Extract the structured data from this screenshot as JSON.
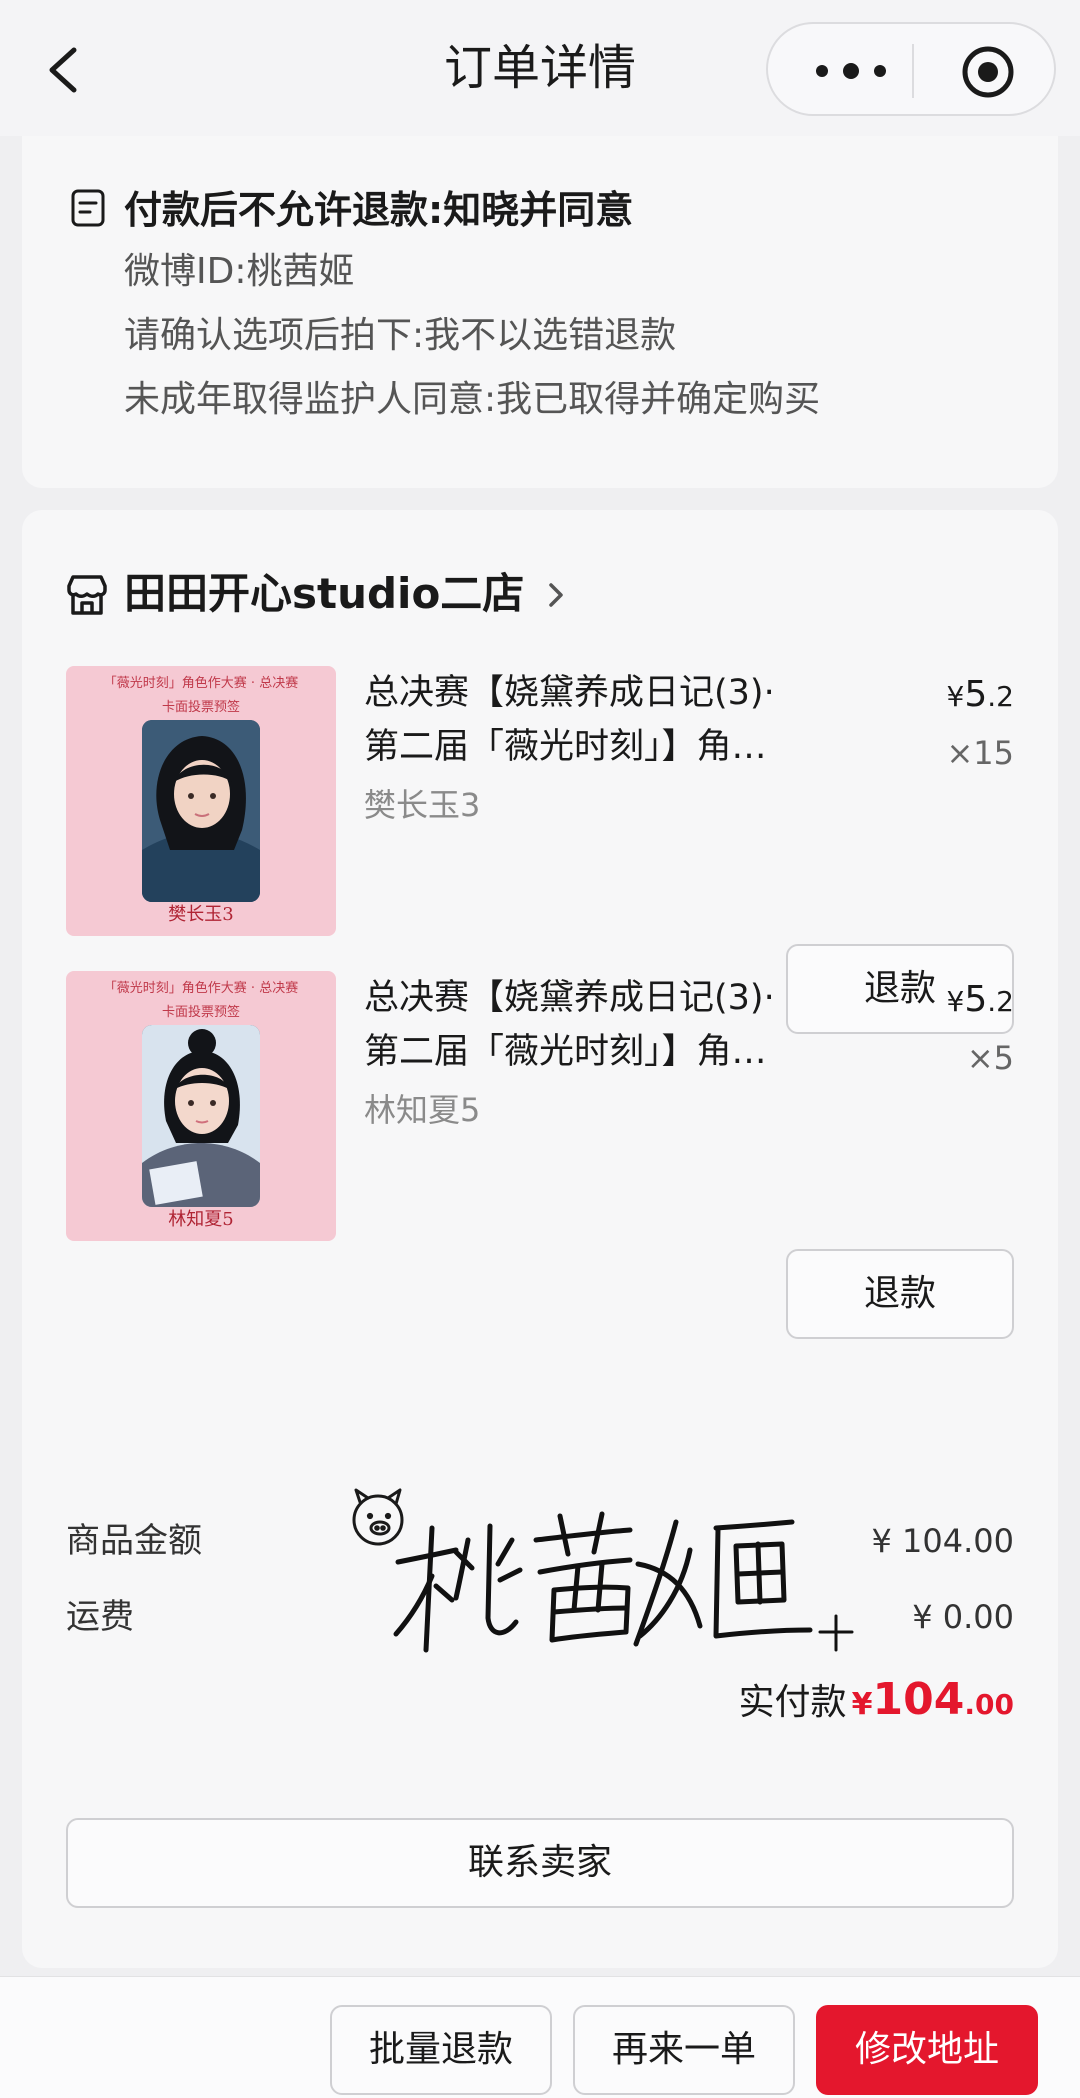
{
  "nav": {
    "title": "订单详情",
    "back_icon": "chevron-left-icon",
    "more_icon": "more-dots-icon",
    "close_icon": "target-circle-icon"
  },
  "remark": {
    "title": "付款后不允许退款:知晓并同意",
    "lines": [
      "微博ID:桃茜姬",
      "请确认选项后拍下:我不以选错退款",
      "未成年取得监护人同意:我已取得并确定购买"
    ]
  },
  "shop": {
    "name": "田田开心studio二店"
  },
  "items": [
    {
      "title_line1": "总决赛【娆黛养成日记(3)·",
      "title_line2": "第二届「薇光时刻」】角…",
      "spec": "樊长玉3",
      "price_currency": "¥",
      "price_int": "5",
      "price_dec": ".2",
      "qty": "×15",
      "refund_label": "退款",
      "thumb_header": "「薇光时刻」角色作大赛 · 总决赛",
      "thumb_sub": "卡面投票预签",
      "thumb_name": "樊长玉3"
    },
    {
      "title_line1": "总决赛【娆黛养成日记(3)·",
      "title_line2": "第二届「薇光时刻」】角…",
      "spec": "林知夏5",
      "price_currency": "¥",
      "price_int": "5",
      "price_dec": ".2",
      "qty": "×5",
      "refund_label": "退款",
      "thumb_header": "「薇光时刻」角色作大赛 · 总决赛",
      "thumb_sub": "卡面投票预签",
      "thumb_name": "林知夏5"
    }
  ],
  "summary": {
    "goods_label": "商品金额",
    "goods_value": "¥ 104.00",
    "shipping_label": "运费",
    "shipping_value": "¥ 0.00",
    "paid_label": "实付款",
    "paid_currency": "¥",
    "paid_int": "104",
    "paid_dec": ".00"
  },
  "signature_text": "桃茜姬",
  "contact_label": "联系卖家",
  "actions": {
    "batch_refund": "批量退款",
    "reorder": "再来一单",
    "modify_address": "修改地址"
  },
  "colors": {
    "accent": "#e4172d",
    "background": "#efeff1",
    "card": "#f7f7f8"
  }
}
